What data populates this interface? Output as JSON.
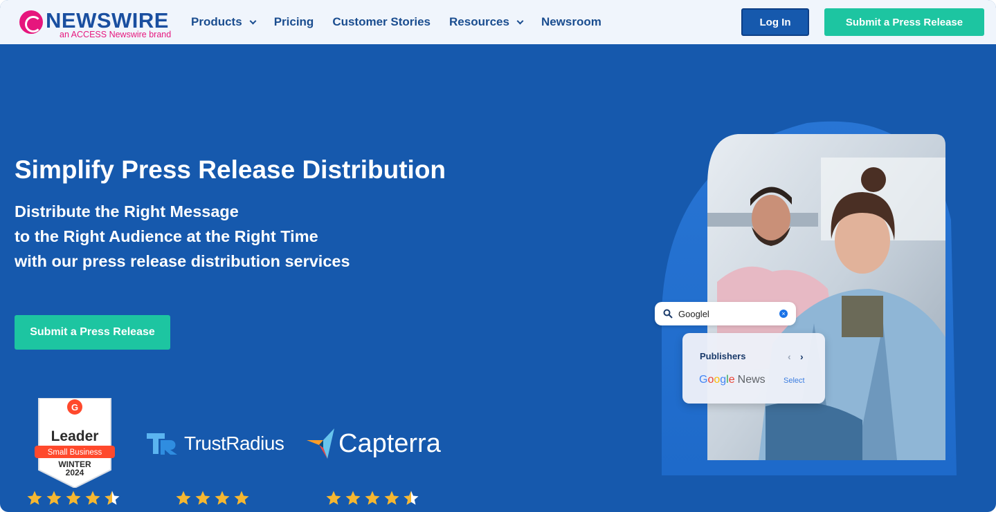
{
  "brand": {
    "logo_word": "NEWSWIRE",
    "logo_sub": "an ACCESS Newswire brand",
    "logo_mark_icon": "access-logo-icon",
    "brand_pink": "#e6167d",
    "brand_blue": "#1a4fa0"
  },
  "nav": {
    "items": [
      {
        "label": "Products",
        "has_dropdown": true
      },
      {
        "label": "Pricing",
        "has_dropdown": false
      },
      {
        "label": "Customer Stories",
        "has_dropdown": false
      },
      {
        "label": "Resources",
        "has_dropdown": true
      },
      {
        "label": "Newsroom",
        "has_dropdown": false
      }
    ],
    "login_label": "Log In",
    "submit_label": "Submit a Press Release"
  },
  "hero": {
    "title": "Simplify Press Release Distribution",
    "subtitle_lines": [
      "Distribute the Right Message",
      "to the Right Audience at the Right Time",
      "with our press release distribution services"
    ],
    "cta_label": "Submit a Press Release",
    "background_color": "#1659ad",
    "accent_color": "#1dc5a1"
  },
  "badges": {
    "g2": {
      "title": "Leader",
      "ribbon": "Small Business",
      "season": "WINTER",
      "year": "2024",
      "rating": 4.5
    },
    "trustradius": {
      "name": "TrustRadius",
      "rating": 4
    },
    "capterra": {
      "name": "Capterra",
      "rating": 4.5
    },
    "star_color": "#f5b731"
  },
  "illustration": {
    "search_query": "Googlel",
    "search_icon": "search-icon",
    "clear_icon": "clear-icon",
    "publishers_title": "Publishers",
    "publisher_name_google": "Google",
    "publisher_name_news": "News",
    "select_label": "Select"
  }
}
